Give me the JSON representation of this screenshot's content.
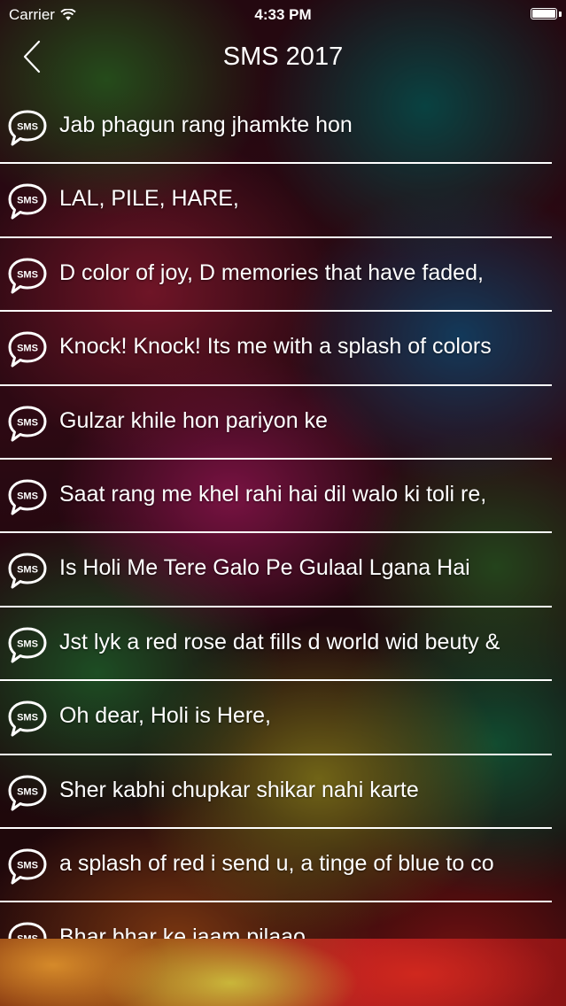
{
  "status_bar": {
    "carrier": "Carrier",
    "time": "4:33 PM",
    "battery_level": 1.0
  },
  "nav": {
    "title": "SMS 2017",
    "back_icon": "chevron-left-icon"
  },
  "list": {
    "icon_label": "SMS",
    "items": [
      "Jab phagun rang jhamkte hon",
      "LAL, PILE, HARE,",
      "D color of joy, D memories that have faded,",
      "Knock! Knock! Its me with a splash of colors",
      "Gulzar khile hon pariyon ke",
      "Saat rang me khel rahi hai dil walo ki toli re,",
      "Is Holi Me Tere Galo Pe Gulaal Lgana Hai",
      "Jst lyk a red rose dat fills d world wid beuty &",
      "Oh dear, Holi is Here,",
      "Sher kabhi chupkar shikar nahi karte",
      "a splash of red i send u, a tinge of blue to co",
      "Bhar bhar ke jaam pilaao"
    ]
  },
  "colors": {
    "text": "#ffffff",
    "separator": "#ffffff"
  }
}
